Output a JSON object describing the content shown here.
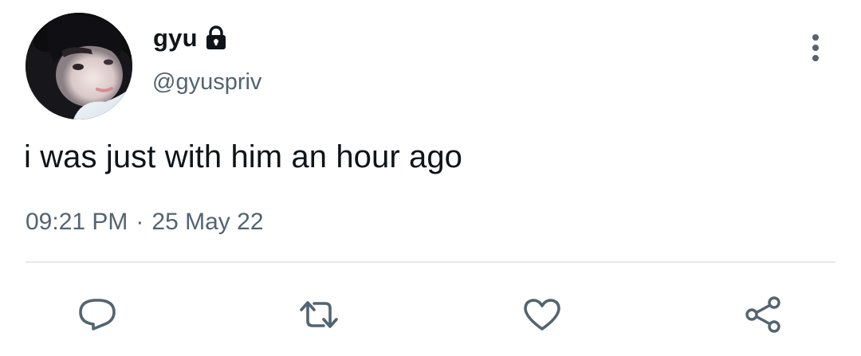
{
  "author": {
    "display_name": "gyu",
    "handle": "@gyuspriv",
    "protected_icon": "lock-icon",
    "avatar": "profile-photo"
  },
  "tweet": {
    "text": "i was just with him an hour ago",
    "time": "09:21 PM",
    "separator": "·",
    "date": "25 May 22"
  },
  "actions": [
    {
      "name": "reply",
      "icon": "comment-bubble-icon"
    },
    {
      "name": "retweet",
      "icon": "retweet-icon"
    },
    {
      "name": "like",
      "icon": "heart-icon"
    },
    {
      "name": "share",
      "icon": "share-nodes-icon"
    }
  ],
  "menu_icon": "more-vertical-icon",
  "colors": {
    "text_primary": "#0f1419",
    "text_secondary": "#536471",
    "icon": "#536471",
    "divider": "#e6e9eb",
    "background": "#ffffff"
  }
}
